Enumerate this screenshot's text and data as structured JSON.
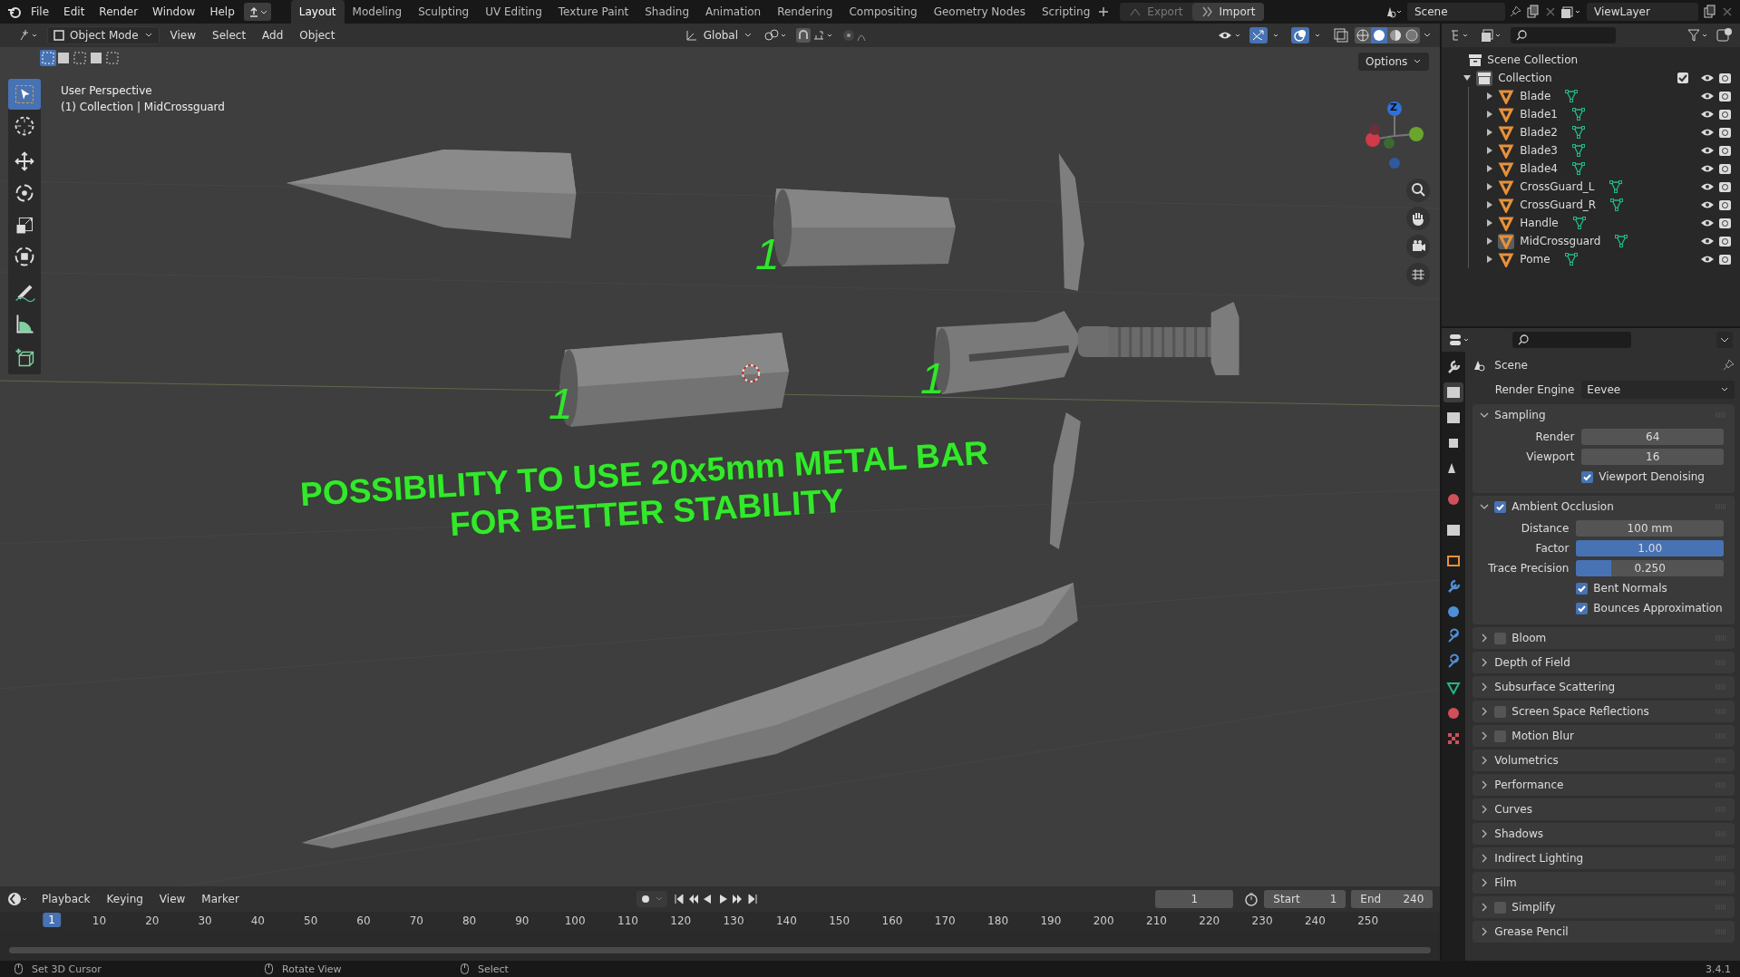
{
  "top_bar": {
    "menus": [
      "File",
      "Edit",
      "Render",
      "Window",
      "Help"
    ],
    "workspaces": [
      {
        "label": "Layout",
        "selected": true
      },
      {
        "label": "Modeling",
        "selected": false
      },
      {
        "label": "Sculpting",
        "selected": false
      },
      {
        "label": "UV Editing",
        "selected": false
      },
      {
        "label": "Texture Paint",
        "selected": false
      },
      {
        "label": "Shading",
        "selected": false
      },
      {
        "label": "Animation",
        "selected": false
      },
      {
        "label": "Rendering",
        "selected": false
      },
      {
        "label": "Compositing",
        "selected": false
      },
      {
        "label": "Geometry Nodes",
        "selected": false
      },
      {
        "label": "Scripting",
        "selected": false
      }
    ],
    "export": "Export",
    "import": "Import",
    "scene": "Scene",
    "view_layer": "ViewLayer"
  },
  "viewport_header": {
    "mode": "Object Mode",
    "menus": [
      "View",
      "Select",
      "Add",
      "Object"
    ],
    "orientation": "Global",
    "options": "Options"
  },
  "viewport": {
    "perspective": "User Perspective",
    "context": "(1) Collection | MidCrossguard",
    "gizmo_axis": "Z",
    "annotation": [
      "POSSIBILITY TO USE 20x5mm METAL BAR",
      "FOR BETTER STABILITY"
    ],
    "part_marks": [
      "1",
      "1",
      "1"
    ]
  },
  "outliner": {
    "root": "Scene Collection",
    "collection": {
      "name": "Collection",
      "expanded": true,
      "checked": true,
      "children": [
        {
          "name": "Blade",
          "selected": false
        },
        {
          "name": "Blade1",
          "selected": false
        },
        {
          "name": "Blade2",
          "selected": false
        },
        {
          "name": "Blade3",
          "selected": false
        },
        {
          "name": "Blade4",
          "selected": false
        },
        {
          "name": "CrossGuard_L",
          "selected": false
        },
        {
          "name": "CrossGuard_R",
          "selected": false
        },
        {
          "name": "Handle",
          "selected": false
        },
        {
          "name": "MidCrossguard",
          "selected": true
        },
        {
          "name": "Pome",
          "selected": false
        }
      ]
    }
  },
  "properties": {
    "tabs": [
      {
        "kind": "tool",
        "selected": false
      },
      {
        "kind": "render",
        "selected": true
      },
      {
        "kind": "output",
        "selected": false
      },
      {
        "kind": "view_layer",
        "selected": false
      },
      {
        "kind": "scene",
        "selected": false
      },
      {
        "kind": "world",
        "selected": false
      },
      {
        "kind": "collection",
        "selected": false
      },
      {
        "kind": "object",
        "selected": false
      },
      {
        "kind": "modifiers",
        "selected": false
      },
      {
        "kind": "particles",
        "selected": false
      },
      {
        "kind": "physics",
        "selected": false
      },
      {
        "kind": "constraints",
        "selected": false
      },
      {
        "kind": "data",
        "selected": false
      },
      {
        "kind": "material",
        "selected": false
      },
      {
        "kind": "texture",
        "selected": false
      }
    ],
    "context": "Scene",
    "render_engine_label": "Render Engine",
    "render_engine": "Eevee",
    "panels": [
      {
        "title": "Sampling",
        "expanded": true,
        "rows": [
          {
            "kind": "field",
            "label": "Render",
            "value": "64"
          },
          {
            "kind": "field",
            "label": "Viewport",
            "value": "16"
          },
          {
            "kind": "checkbox",
            "label": "Viewport Denoising",
            "checked": true
          }
        ]
      },
      {
        "title": "Ambient Occlusion",
        "expanded": true,
        "checked": true,
        "rows": [
          {
            "kind": "field",
            "label": "Distance",
            "value": "100 mm"
          },
          {
            "kind": "slider",
            "label": "Factor",
            "value": "1.00",
            "level": 1
          },
          {
            "kind": "slider",
            "label": "Trace Precision",
            "value": "0.250",
            "level": 0.24
          },
          {
            "kind": "checkbox",
            "label": "Bent Normals",
            "checked": true
          },
          {
            "kind": "checkbox",
            "label": "Bounces Approximation",
            "checked": true
          }
        ]
      },
      {
        "title": "Bloom",
        "expanded": false,
        "checked": false
      },
      {
        "title": "Depth of Field",
        "expanded": false
      },
      {
        "title": "Subsurface Scattering",
        "expanded": false
      },
      {
        "title": "Screen Space Reflections",
        "expanded": false,
        "checked": false
      },
      {
        "title": "Motion Blur",
        "expanded": false,
        "checked": false
      },
      {
        "title": "Volumetrics",
        "expanded": false
      },
      {
        "title": "Performance",
        "expanded": false
      },
      {
        "title": "Curves",
        "expanded": false
      },
      {
        "title": "Shadows",
        "expanded": false
      },
      {
        "title": "Indirect Lighting",
        "expanded": false
      },
      {
        "title": "Film",
        "expanded": false
      },
      {
        "title": "Simplify",
        "expanded": false,
        "checked": false
      },
      {
        "title": "Grease Pencil",
        "expanded": false
      }
    ]
  },
  "timeline": {
    "menus": [
      "Playback",
      "Keying",
      "View",
      "Marker"
    ],
    "current_frame": "1",
    "start_label": "Start",
    "start": "1",
    "end_label": "End",
    "end": "240",
    "ticks": [
      {
        "label": "1",
        "selected": true
      },
      {
        "label": "10",
        "selected": false
      },
      {
        "label": "20",
        "selected": false
      },
      {
        "label": "30",
        "selected": false
      },
      {
        "label": "40",
        "selected": false
      },
      {
        "label": "50",
        "selected": false
      },
      {
        "label": "60",
        "selected": false
      },
      {
        "label": "70",
        "selected": false
      },
      {
        "label": "80",
        "selected": false
      },
      {
        "label": "90",
        "selected": false
      },
      {
        "label": "100",
        "selected": false
      },
      {
        "label": "110",
        "selected": false
      },
      {
        "label": "120",
        "selected": false
      },
      {
        "label": "130",
        "selected": false
      },
      {
        "label": "140",
        "selected": false
      },
      {
        "label": "150",
        "selected": false
      },
      {
        "label": "160",
        "selected": false
      },
      {
        "label": "170",
        "selected": false
      },
      {
        "label": "180",
        "selected": false
      },
      {
        "label": "190",
        "selected": false
      },
      {
        "label": "200",
        "selected": false
      },
      {
        "label": "210",
        "selected": false
      },
      {
        "label": "220",
        "selected": false
      },
      {
        "label": "230",
        "selected": false
      },
      {
        "label": "240",
        "selected": false
      },
      {
        "label": "250",
        "selected": false
      }
    ]
  },
  "status_bar": {
    "hints": [
      "Set 3D Cursor",
      "Rotate View",
      "Select"
    ],
    "version": "3.4.1"
  }
}
